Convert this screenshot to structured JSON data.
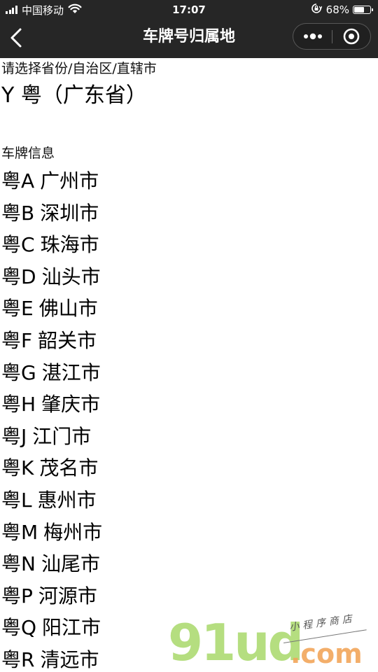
{
  "status_bar": {
    "carrier": "中国移动",
    "time": "17:07",
    "battery_percent": "68%",
    "battery_level": 0.68,
    "icons": [
      "signal-icon",
      "wifi-icon",
      "orientation-lock-icon",
      "battery-icon"
    ]
  },
  "nav_bar": {
    "title": "车牌号归属地",
    "back_icon": "chevron-left-icon",
    "more_icon": "more-dots-icon",
    "close_icon": "target-close-icon"
  },
  "province_section": {
    "label": "请选择省份/自治区/直辖市",
    "selected": "Y 粤（广东省）"
  },
  "plates_section": {
    "label": "车牌信息",
    "items": [
      {
        "code": "粤A",
        "city": "广州市"
      },
      {
        "code": "粤B",
        "city": "深圳市"
      },
      {
        "code": "粤C",
        "city": "珠海市"
      },
      {
        "code": "粤D",
        "city": "汕头市"
      },
      {
        "code": "粤E",
        "city": "佛山市"
      },
      {
        "code": "粤F",
        "city": "韶关市"
      },
      {
        "code": "粤G",
        "city": "湛江市"
      },
      {
        "code": "粤H",
        "city": "肇庆市"
      },
      {
        "code": "粤J",
        "city": "江门市"
      },
      {
        "code": "粤K",
        "city": "茂名市"
      },
      {
        "code": "粤L",
        "city": "惠州市"
      },
      {
        "code": "粤M",
        "city": "梅州市"
      },
      {
        "code": "粤N",
        "city": "汕尾市"
      },
      {
        "code": "粤P",
        "city": "河源市"
      },
      {
        "code": "粤Q",
        "city": "阳江市"
      },
      {
        "code": "粤R",
        "city": "清远市"
      }
    ]
  },
  "watermark": {
    "main": "91ud",
    "domain": ".com",
    "sub": "小程序商店"
  },
  "colors": {
    "nav_background": "#262626",
    "watermark_green": "#a9d96b",
    "watermark_orange": "#f2a65a"
  }
}
